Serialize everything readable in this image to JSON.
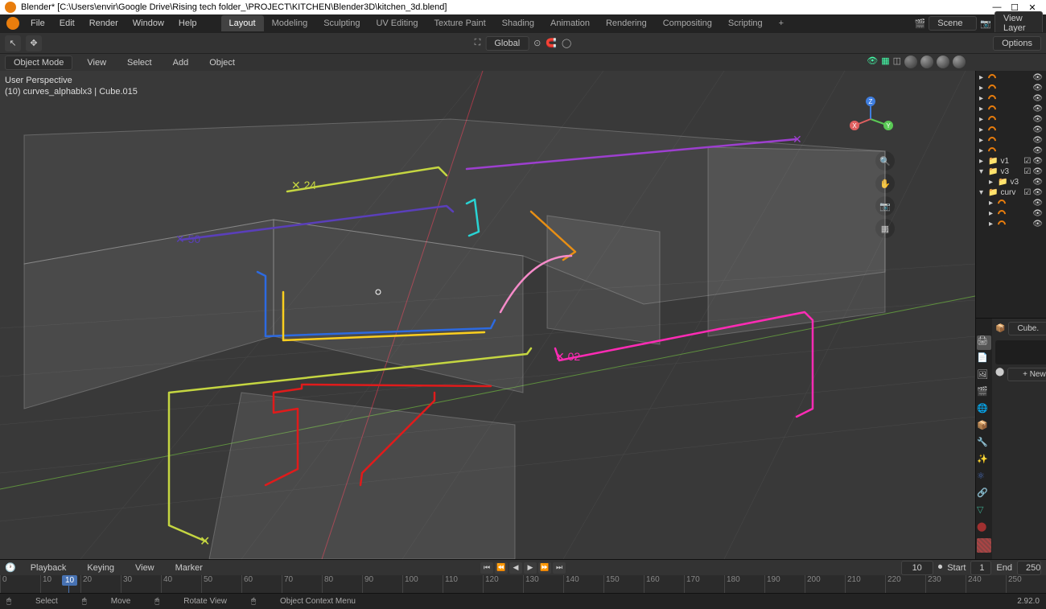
{
  "window": {
    "title": "Blender* [C:\\Users\\envir\\Google Drive\\Rising tech folder_\\PROJECT\\KITCHEN\\Blender3D\\kitchen_3d.blend]",
    "minimize": "—",
    "maximize": "☐",
    "close": "✕"
  },
  "topmenu": {
    "file": "File",
    "edit": "Edit",
    "render": "Render",
    "window": "Window",
    "help": "Help"
  },
  "workspaces": {
    "layout": "Layout",
    "modeling": "Modeling",
    "sculpting": "Sculpting",
    "uv": "UV Editing",
    "texture": "Texture Paint",
    "shading": "Shading",
    "animation": "Animation",
    "rendering": "Rendering",
    "compositing": "Compositing",
    "scripting": "Scripting",
    "plus": "+"
  },
  "scene": {
    "scene_icon": "🎬",
    "scene_name": "Scene",
    "layer_icon": "📷",
    "layer_name": "View Layer"
  },
  "header3": {
    "mode": "Object Mode",
    "view": "View",
    "select": "Select",
    "add": "Add",
    "object": "Object",
    "global": "Global",
    "options": "Options"
  },
  "viewport": {
    "line1": "User Perspective",
    "line2": "(10) curves_alphablx3 | Cube.015"
  },
  "outliner_items": [
    {
      "label": "v1"
    },
    {
      "label": "v3"
    },
    {
      "label": "v3"
    },
    {
      "label": "curv"
    }
  ],
  "properties": {
    "cube_label": "Cube.",
    "new_btn": "+ New"
  },
  "timeline": {
    "playback": "Playback",
    "keying": "Keying",
    "view": "View",
    "marker": "Marker",
    "frame_field": "10",
    "start_label": "Start",
    "start_val": "1",
    "end_label": "End",
    "end_val": "250",
    "ticks": [
      "0",
      "10",
      "20",
      "30",
      "40",
      "50",
      "60",
      "70",
      "80",
      "90",
      "100",
      "110",
      "120",
      "130",
      "140",
      "150",
      "160",
      "170",
      "180",
      "190",
      "200",
      "210",
      "220",
      "230",
      "240",
      "250"
    ],
    "playhead": "10"
  },
  "statusbar": {
    "select": "Select",
    "move": "Move",
    "rotate": "Rotate View",
    "menu": "Object Context Menu",
    "version": "2.92.0"
  },
  "colors": {
    "lime": "#c5d641",
    "red": "#e01b1b",
    "blue": "#2d6ae0",
    "orange": "#e88f14",
    "purple": "#9d3fcf",
    "indigo": "#5a3fba",
    "cyan": "#29d4d4",
    "pink": "#ed3a9e",
    "magenta": "#ff2bb5",
    "yellow": "#fccf1e"
  }
}
